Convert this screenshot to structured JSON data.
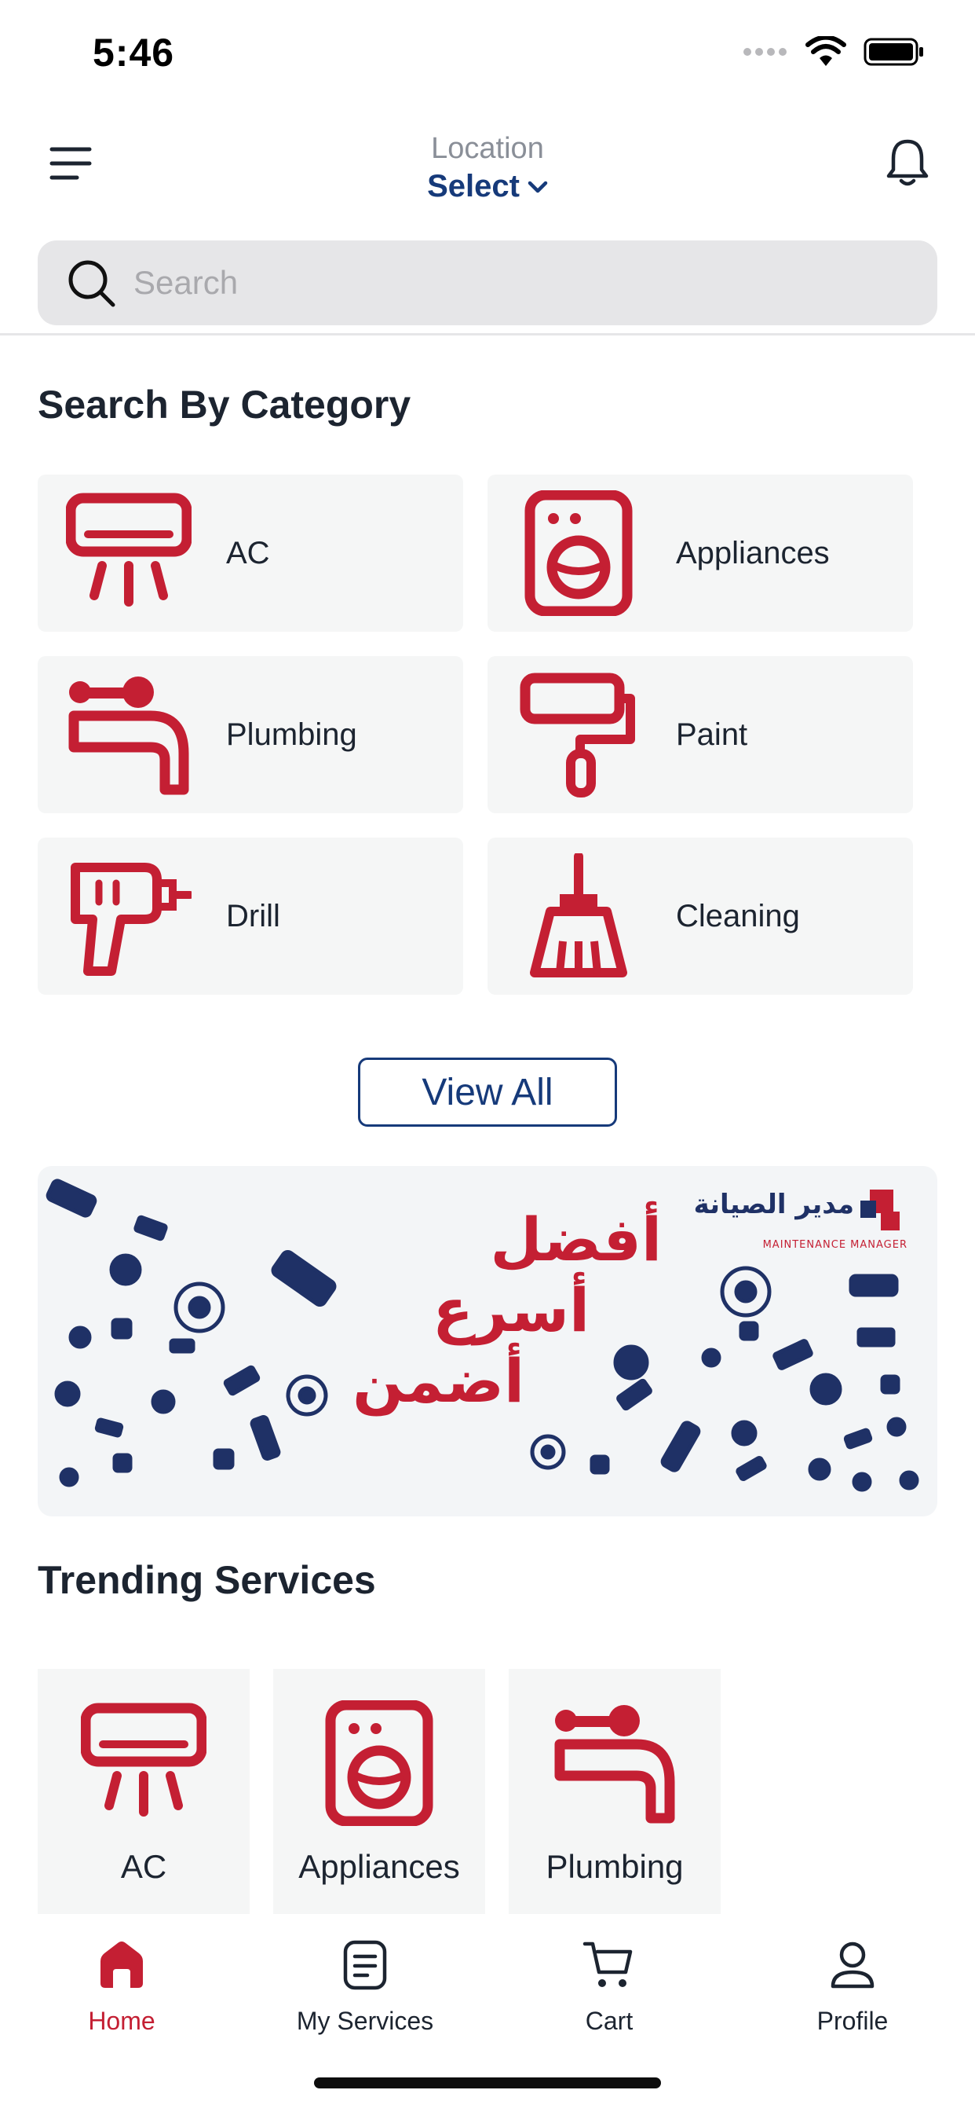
{
  "status": {
    "time": "5:46"
  },
  "header": {
    "location_label": "Location",
    "location_value": "Select",
    "menu_icon": "hamburger-menu-icon",
    "bell_icon": "bell-icon"
  },
  "search": {
    "placeholder": "Search"
  },
  "categories": {
    "title": "Search By Category",
    "items": [
      {
        "label": "AC",
        "icon": "ac-unit-icon"
      },
      {
        "label": "Appliances",
        "icon": "washing-machine-icon"
      },
      {
        "label": "Plumbing",
        "icon": "faucet-icon"
      },
      {
        "label": "Paint",
        "icon": "paint-roller-icon"
      },
      {
        "label": "Drill",
        "icon": "drill-icon"
      },
      {
        "label": "Cleaning",
        "icon": "broom-icon"
      }
    ],
    "view_all_label": "View All"
  },
  "banner": {
    "line1": "أفضل",
    "line2": "أسرع",
    "line3": "أضمن",
    "logo_ar": "مدير الصيانة",
    "logo_en": "MAINTENANCE MANAGER"
  },
  "trending": {
    "title": "Trending Services",
    "items": [
      {
        "label": "AC",
        "icon": "ac-unit-icon"
      },
      {
        "label": "Appliances",
        "icon": "washing-machine-icon"
      },
      {
        "label": "Plumbing",
        "icon": "faucet-icon"
      }
    ]
  },
  "tabs": [
    {
      "label": "Home",
      "icon": "home-icon",
      "active": true
    },
    {
      "label": "My Services",
      "icon": "document-icon",
      "active": false
    },
    {
      "label": "Cart",
      "icon": "cart-icon",
      "active": false
    },
    {
      "label": "Profile",
      "icon": "user-icon",
      "active": false
    }
  ],
  "colors": {
    "accent": "#c41f33",
    "brand_navy": "#163a7a",
    "card_bg": "#f5f6f6",
    "search_bg": "#e6e6e8"
  }
}
